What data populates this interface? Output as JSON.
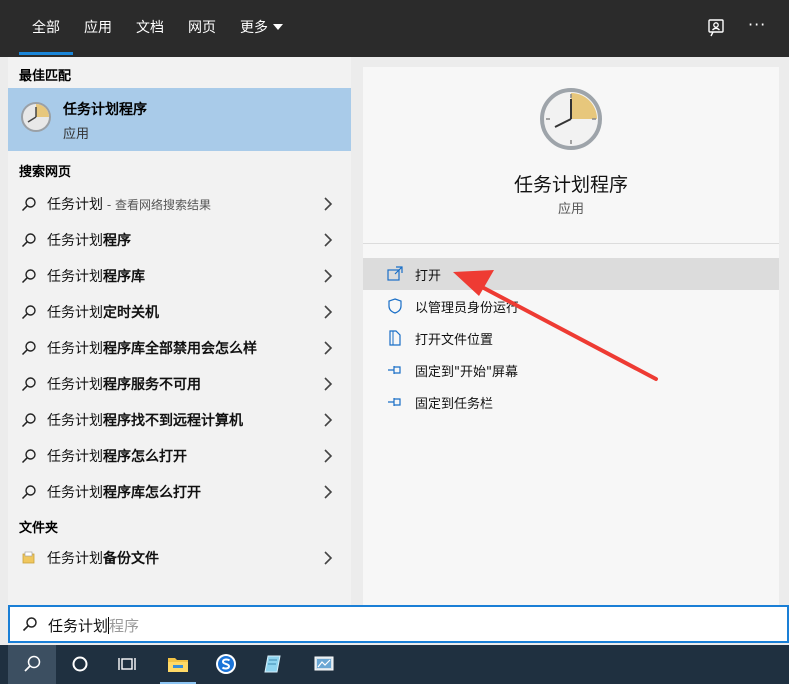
{
  "tabs": [
    {
      "label": "全部",
      "active": true
    },
    {
      "label": "应用",
      "active": false
    },
    {
      "label": "文档",
      "active": false
    },
    {
      "label": "网页",
      "active": false
    },
    {
      "label": "更多",
      "active": false
    }
  ],
  "top_icons": [
    "feedback-icon",
    "more-options-icon"
  ],
  "more_options_glyph": "···",
  "best_match": {
    "section": "最佳匹配",
    "name": "任务计划程序",
    "type": "应用"
  },
  "web_search": {
    "section": "搜索网页",
    "items": [
      {
        "prefix": "任务计划",
        "bold": "",
        "hint": " - 查看网络搜索结果"
      },
      {
        "prefix": "任务计划",
        "bold": "程序",
        "hint": ""
      },
      {
        "prefix": "任务计划",
        "bold": "程序库",
        "hint": ""
      },
      {
        "prefix": "任务计划",
        "bold": "定时关机",
        "hint": ""
      },
      {
        "prefix": "任务计划",
        "bold": "程序库全部禁用会怎么样",
        "hint": ""
      },
      {
        "prefix": "任务计划",
        "bold": "程序服务不可用",
        "hint": ""
      },
      {
        "prefix": "任务计划",
        "bold": "程序找不到远程计算机",
        "hint": ""
      },
      {
        "prefix": "任务计划",
        "bold": "程序怎么打开",
        "hint": ""
      },
      {
        "prefix": "任务计划",
        "bold": "程序库怎么打开",
        "hint": ""
      }
    ]
  },
  "folders": {
    "section": "文件夹",
    "items": [
      {
        "prefix": "任务计划",
        "bold": "备份文件"
      }
    ]
  },
  "detail": {
    "title": "任务计划程序",
    "type": "应用",
    "actions": [
      {
        "label": "打开",
        "icon": "open-icon",
        "highlighted": true
      },
      {
        "label": "以管理员身份运行",
        "icon": "shield-icon",
        "highlighted": false
      },
      {
        "label": "打开文件位置",
        "icon": "file-location-icon",
        "highlighted": false
      },
      {
        "label": "固定到\"开始\"屏幕",
        "icon": "pin-icon",
        "highlighted": false
      },
      {
        "label": "固定到任务栏",
        "icon": "pin-icon",
        "highlighted": false
      }
    ]
  },
  "search": {
    "typed": "任务计划",
    "suggestion": "程序"
  },
  "taskbar": [
    {
      "name": "search-icon",
      "active": true
    },
    {
      "name": "cortana-icon",
      "active": false
    },
    {
      "name": "task-view-icon",
      "active": false
    },
    {
      "name": "file-explorer-icon",
      "active": false
    },
    {
      "name": "sogou-browser-icon",
      "active": false
    },
    {
      "name": "notepad-icon",
      "active": false
    },
    {
      "name": "control-panel-icon",
      "active": false
    }
  ],
  "colors": {
    "accent": "#1a86d9",
    "topbar": "#2b2b2b",
    "selected": "#a9cbe9",
    "taskbar": "#1f3040",
    "annotation_arrow": "#ee3b33"
  }
}
